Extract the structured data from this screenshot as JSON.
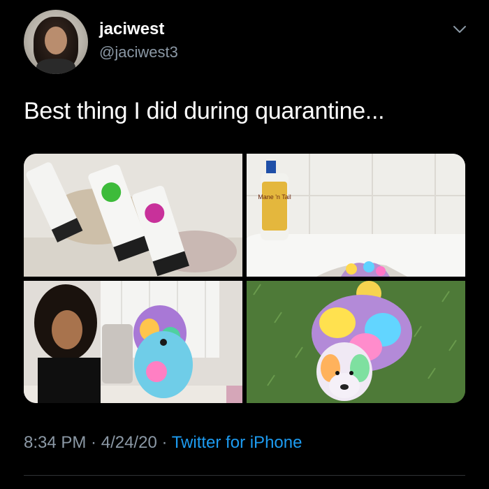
{
  "tweet": {
    "display_name": "jaciwest",
    "handle": "@jaciwest3",
    "text": "Best thing I did during quarantine...",
    "time": "8:34 PM",
    "separator": " · ",
    "date": "4/24/20",
    "source": "Twitter for iPhone"
  },
  "media": {
    "images": [
      {
        "subject": "dog-hair-dye-tubes-photo"
      },
      {
        "subject": "bathtub-shampoo-bottle-photo"
      },
      {
        "subject": "mirror-selfie-with-rainbow-dog-photo"
      },
      {
        "subject": "rainbow-dog-on-grass-photo"
      }
    ],
    "product_label": "Mane 'n Tail"
  },
  "colors": {
    "background": "#000000",
    "secondary_text": "#8b98a5",
    "link": "#1d9bf0"
  }
}
